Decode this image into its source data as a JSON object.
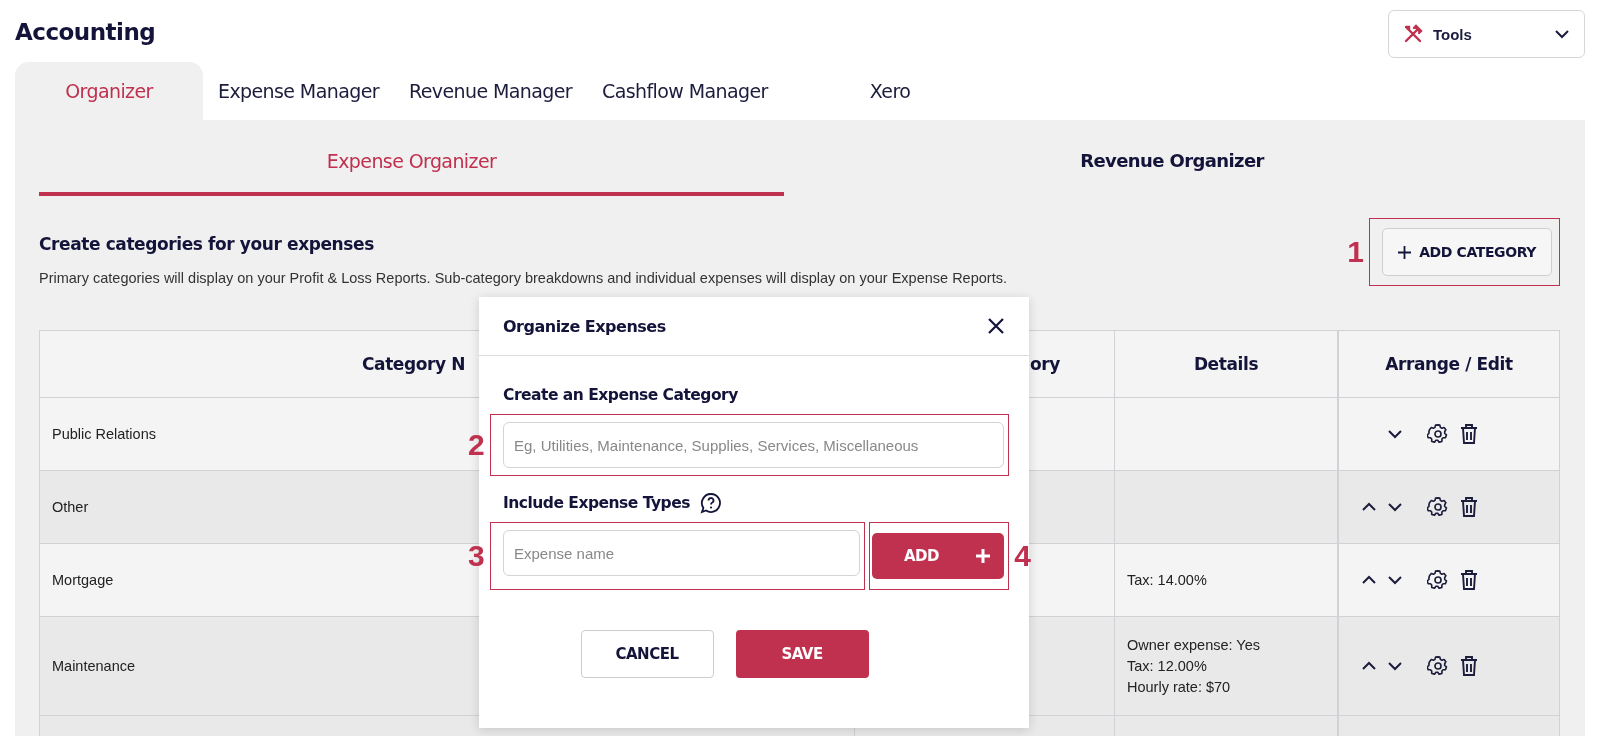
{
  "page": {
    "title": "Accounting"
  },
  "tools_menu": {
    "label": "Tools"
  },
  "tabs": [
    {
      "label": "Organizer",
      "selected": true
    },
    {
      "label": "Expense Manager",
      "selected": false
    },
    {
      "label": "Revenue Manager",
      "selected": false
    },
    {
      "label": "Cashflow Manager",
      "selected": false
    },
    {
      "label": "Xero",
      "selected": false
    }
  ],
  "sub_tabs": [
    {
      "label": "Expense Organizer",
      "selected": true
    },
    {
      "label": "Revenue Organizer",
      "selected": false
    }
  ],
  "section": {
    "heading": "Create categories for your expenses",
    "description": "Primary categories will display on your Profit & Loss Reports. Sub-category breakdowns and individual expenses will display on your Expense Reports.",
    "add_button": {
      "label": "ADD CATEGORY",
      "callout": "1"
    }
  },
  "table": {
    "columns": [
      "Category N",
      "ory",
      "Details",
      "Arrange / Edit"
    ],
    "rows": [
      {
        "name": "Public Relations",
        "move_up": false
      },
      {
        "name": "Other",
        "move_up": true
      },
      {
        "name": "Mortgage",
        "details": [
          "Tax: 14.00%"
        ],
        "move_up": true
      },
      {
        "name": "Maintenance",
        "details": [
          "Owner expense: Yes",
          "Tax: 12.00%",
          "Hourly rate: $70"
        ],
        "move_up": true
      }
    ]
  },
  "modal": {
    "title": "Organize Expenses",
    "category_label": "Create an Expense Category",
    "category_field": {
      "placeholder": "Eg, Utilities, Maintenance, Supplies, Services, Miscellaneous",
      "callout": "2"
    },
    "types_label": "Include Expense Types",
    "expense_field": {
      "placeholder": "Expense name",
      "callout": "3"
    },
    "add_button": {
      "label": "ADD",
      "callout": "4"
    },
    "buttons": [
      {
        "label": "CANCEL",
        "kind": "secondary"
      },
      {
        "label": "SAVE",
        "kind": "primary"
      }
    ]
  }
}
